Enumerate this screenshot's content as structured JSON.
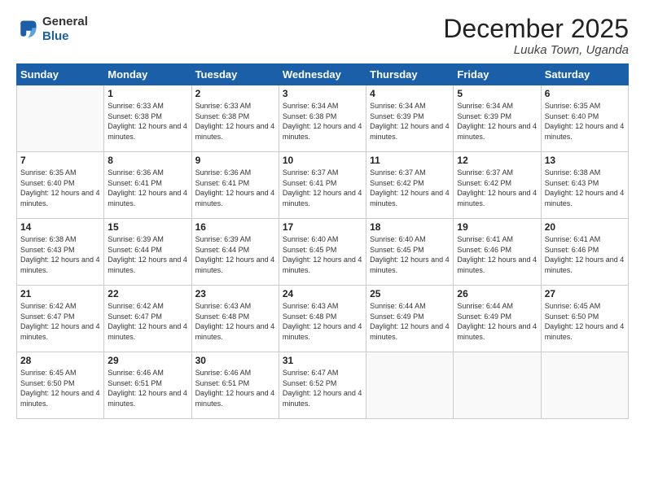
{
  "header": {
    "logo_general": "General",
    "logo_blue": "Blue",
    "month_year": "December 2025",
    "location": "Luuka Town, Uganda"
  },
  "weekdays": [
    "Sunday",
    "Monday",
    "Tuesday",
    "Wednesday",
    "Thursday",
    "Friday",
    "Saturday"
  ],
  "weeks": [
    [
      {
        "day": "",
        "sunrise": "",
        "sunset": "",
        "daylight": "",
        "empty": true
      },
      {
        "day": "1",
        "sunrise": "Sunrise: 6:33 AM",
        "sunset": "Sunset: 6:38 PM",
        "daylight": "Daylight: 12 hours and 4 minutes."
      },
      {
        "day": "2",
        "sunrise": "Sunrise: 6:33 AM",
        "sunset": "Sunset: 6:38 PM",
        "daylight": "Daylight: 12 hours and 4 minutes."
      },
      {
        "day": "3",
        "sunrise": "Sunrise: 6:34 AM",
        "sunset": "Sunset: 6:38 PM",
        "daylight": "Daylight: 12 hours and 4 minutes."
      },
      {
        "day": "4",
        "sunrise": "Sunrise: 6:34 AM",
        "sunset": "Sunset: 6:39 PM",
        "daylight": "Daylight: 12 hours and 4 minutes."
      },
      {
        "day": "5",
        "sunrise": "Sunrise: 6:34 AM",
        "sunset": "Sunset: 6:39 PM",
        "daylight": "Daylight: 12 hours and 4 minutes."
      },
      {
        "day": "6",
        "sunrise": "Sunrise: 6:35 AM",
        "sunset": "Sunset: 6:40 PM",
        "daylight": "Daylight: 12 hours and 4 minutes."
      }
    ],
    [
      {
        "day": "7",
        "sunrise": "Sunrise: 6:35 AM",
        "sunset": "Sunset: 6:40 PM",
        "daylight": "Daylight: 12 hours and 4 minutes."
      },
      {
        "day": "8",
        "sunrise": "Sunrise: 6:36 AM",
        "sunset": "Sunset: 6:41 PM",
        "daylight": "Daylight: 12 hours and 4 minutes."
      },
      {
        "day": "9",
        "sunrise": "Sunrise: 6:36 AM",
        "sunset": "Sunset: 6:41 PM",
        "daylight": "Daylight: 12 hours and 4 minutes."
      },
      {
        "day": "10",
        "sunrise": "Sunrise: 6:37 AM",
        "sunset": "Sunset: 6:41 PM",
        "daylight": "Daylight: 12 hours and 4 minutes."
      },
      {
        "day": "11",
        "sunrise": "Sunrise: 6:37 AM",
        "sunset": "Sunset: 6:42 PM",
        "daylight": "Daylight: 12 hours and 4 minutes."
      },
      {
        "day": "12",
        "sunrise": "Sunrise: 6:37 AM",
        "sunset": "Sunset: 6:42 PM",
        "daylight": "Daylight: 12 hours and 4 minutes."
      },
      {
        "day": "13",
        "sunrise": "Sunrise: 6:38 AM",
        "sunset": "Sunset: 6:43 PM",
        "daylight": "Daylight: 12 hours and 4 minutes."
      }
    ],
    [
      {
        "day": "14",
        "sunrise": "Sunrise: 6:38 AM",
        "sunset": "Sunset: 6:43 PM",
        "daylight": "Daylight: 12 hours and 4 minutes."
      },
      {
        "day": "15",
        "sunrise": "Sunrise: 6:39 AM",
        "sunset": "Sunset: 6:44 PM",
        "daylight": "Daylight: 12 hours and 4 minutes."
      },
      {
        "day": "16",
        "sunrise": "Sunrise: 6:39 AM",
        "sunset": "Sunset: 6:44 PM",
        "daylight": "Daylight: 12 hours and 4 minutes."
      },
      {
        "day": "17",
        "sunrise": "Sunrise: 6:40 AM",
        "sunset": "Sunset: 6:45 PM",
        "daylight": "Daylight: 12 hours and 4 minutes."
      },
      {
        "day": "18",
        "sunrise": "Sunrise: 6:40 AM",
        "sunset": "Sunset: 6:45 PM",
        "daylight": "Daylight: 12 hours and 4 minutes."
      },
      {
        "day": "19",
        "sunrise": "Sunrise: 6:41 AM",
        "sunset": "Sunset: 6:46 PM",
        "daylight": "Daylight: 12 hours and 4 minutes."
      },
      {
        "day": "20",
        "sunrise": "Sunrise: 6:41 AM",
        "sunset": "Sunset: 6:46 PM",
        "daylight": "Daylight: 12 hours and 4 minutes."
      }
    ],
    [
      {
        "day": "21",
        "sunrise": "Sunrise: 6:42 AM",
        "sunset": "Sunset: 6:47 PM",
        "daylight": "Daylight: 12 hours and 4 minutes."
      },
      {
        "day": "22",
        "sunrise": "Sunrise: 6:42 AM",
        "sunset": "Sunset: 6:47 PM",
        "daylight": "Daylight: 12 hours and 4 minutes."
      },
      {
        "day": "23",
        "sunrise": "Sunrise: 6:43 AM",
        "sunset": "Sunset: 6:48 PM",
        "daylight": "Daylight: 12 hours and 4 minutes."
      },
      {
        "day": "24",
        "sunrise": "Sunrise: 6:43 AM",
        "sunset": "Sunset: 6:48 PM",
        "daylight": "Daylight: 12 hours and 4 minutes."
      },
      {
        "day": "25",
        "sunrise": "Sunrise: 6:44 AM",
        "sunset": "Sunset: 6:49 PM",
        "daylight": "Daylight: 12 hours and 4 minutes."
      },
      {
        "day": "26",
        "sunrise": "Sunrise: 6:44 AM",
        "sunset": "Sunset: 6:49 PM",
        "daylight": "Daylight: 12 hours and 4 minutes."
      },
      {
        "day": "27",
        "sunrise": "Sunrise: 6:45 AM",
        "sunset": "Sunset: 6:50 PM",
        "daylight": "Daylight: 12 hours and 4 minutes."
      }
    ],
    [
      {
        "day": "28",
        "sunrise": "Sunrise: 6:45 AM",
        "sunset": "Sunset: 6:50 PM",
        "daylight": "Daylight: 12 hours and 4 minutes."
      },
      {
        "day": "29",
        "sunrise": "Sunrise: 6:46 AM",
        "sunset": "Sunset: 6:51 PM",
        "daylight": "Daylight: 12 hours and 4 minutes."
      },
      {
        "day": "30",
        "sunrise": "Sunrise: 6:46 AM",
        "sunset": "Sunset: 6:51 PM",
        "daylight": "Daylight: 12 hours and 4 minutes."
      },
      {
        "day": "31",
        "sunrise": "Sunrise: 6:47 AM",
        "sunset": "Sunset: 6:52 PM",
        "daylight": "Daylight: 12 hours and 4 minutes."
      },
      {
        "day": "",
        "sunrise": "",
        "sunset": "",
        "daylight": "",
        "empty": true
      },
      {
        "day": "",
        "sunrise": "",
        "sunset": "",
        "daylight": "",
        "empty": true
      },
      {
        "day": "",
        "sunrise": "",
        "sunset": "",
        "daylight": "",
        "empty": true
      }
    ]
  ]
}
